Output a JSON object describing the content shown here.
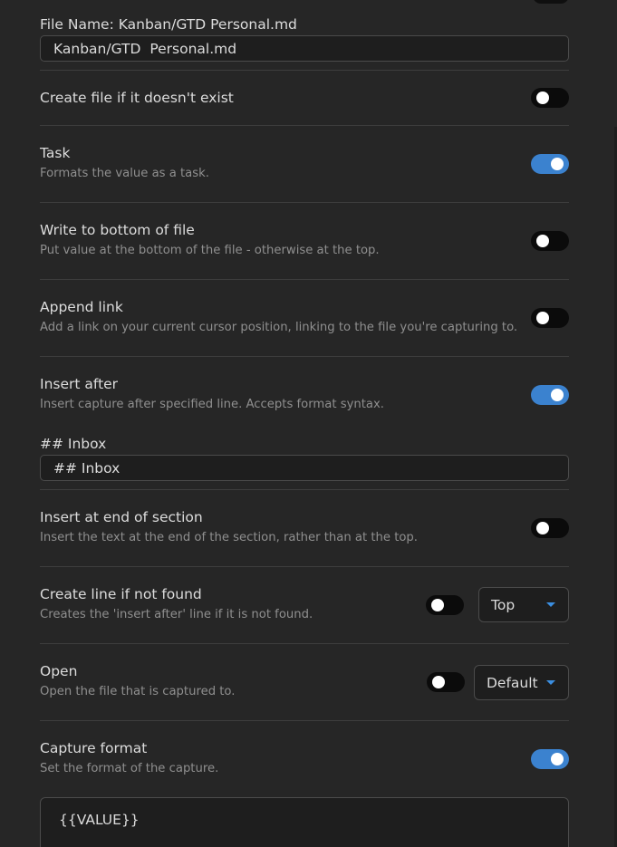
{
  "file_name": {
    "label": "File Name: Kanban/GTD Personal.md",
    "value": "Kanban/GTD  Personal.md"
  },
  "settings": {
    "create_file": {
      "label": "Create file if it doesn't exist",
      "enabled": false
    },
    "task": {
      "label": "Task",
      "description": "Formats the value as a task.",
      "enabled": true
    },
    "write_to_bottom": {
      "label": "Write to bottom of file",
      "description": "Put value at the bottom of the file - otherwise at the top.",
      "enabled": false
    },
    "append_link": {
      "label": "Append link",
      "description": "Add a link on your current cursor position, linking to the file you're capturing to.",
      "enabled": false
    },
    "insert_after": {
      "label": "Insert after",
      "description": "Insert capture after specified line. Accepts format syntax.",
      "enabled": true,
      "field_label": "## Inbox",
      "field_value": "## Inbox"
    },
    "insert_at_end_of_section": {
      "label": "Insert at end of section",
      "description": "Insert the text at the end of the section, rather than at the top.",
      "enabled": false
    },
    "create_line_if_not_found": {
      "label": "Create line if not found",
      "description": "Creates the 'insert after' line if it is not found.",
      "enabled": false,
      "position": "Top"
    },
    "open": {
      "label": "Open",
      "description": "Open the file that is captured to.",
      "enabled": false,
      "mode": "Default"
    },
    "capture_format": {
      "label": "Capture format",
      "description": "Set the format of the capture.",
      "enabled": true,
      "value": "{{VALUE}}"
    }
  },
  "colors": {
    "background": "#262626",
    "toggle_on": "#3b82cf",
    "toggle_off": "#0b0b0b",
    "accent_caret": "#3b8ee0"
  }
}
